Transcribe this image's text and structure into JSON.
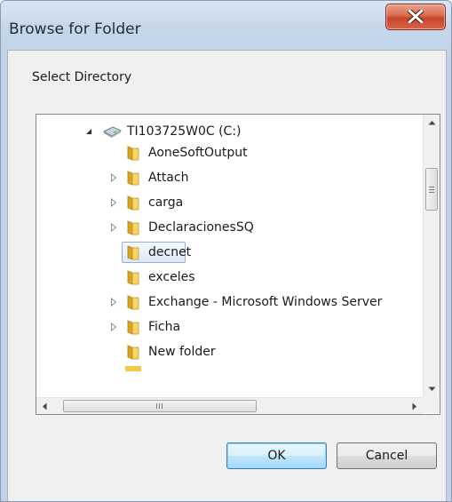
{
  "window": {
    "title": "Browse for Folder",
    "close_icon": "close-x-icon"
  },
  "dialog": {
    "prompt": "Select Directory"
  },
  "tree": {
    "root": {
      "label": "TI103725W0C (C:)",
      "icon": "drive-icon",
      "expanded": true
    },
    "items": [
      {
        "label": "AoneSoftOutput",
        "has_children": false,
        "selected": false
      },
      {
        "label": "Attach",
        "has_children": true,
        "selected": false
      },
      {
        "label": "carga",
        "has_children": true,
        "selected": false
      },
      {
        "label": "DeclaracionesSQ",
        "has_children": true,
        "selected": false
      },
      {
        "label": "decnet",
        "has_children": false,
        "selected": true
      },
      {
        "label": "exceles",
        "has_children": false,
        "selected": false
      },
      {
        "label": "Exchange - Microsoft Windows Server",
        "has_children": true,
        "selected": false
      },
      {
        "label": "Ficha",
        "has_children": true,
        "selected": false
      },
      {
        "label": "New folder",
        "has_children": false,
        "selected": false
      }
    ]
  },
  "buttons": {
    "ok_label": "OK",
    "cancel_label": "Cancel"
  },
  "colors": {
    "selection_border": "#8fb0d8",
    "close_button": "#c8452a",
    "folder_yellow": "#f2c94c"
  }
}
